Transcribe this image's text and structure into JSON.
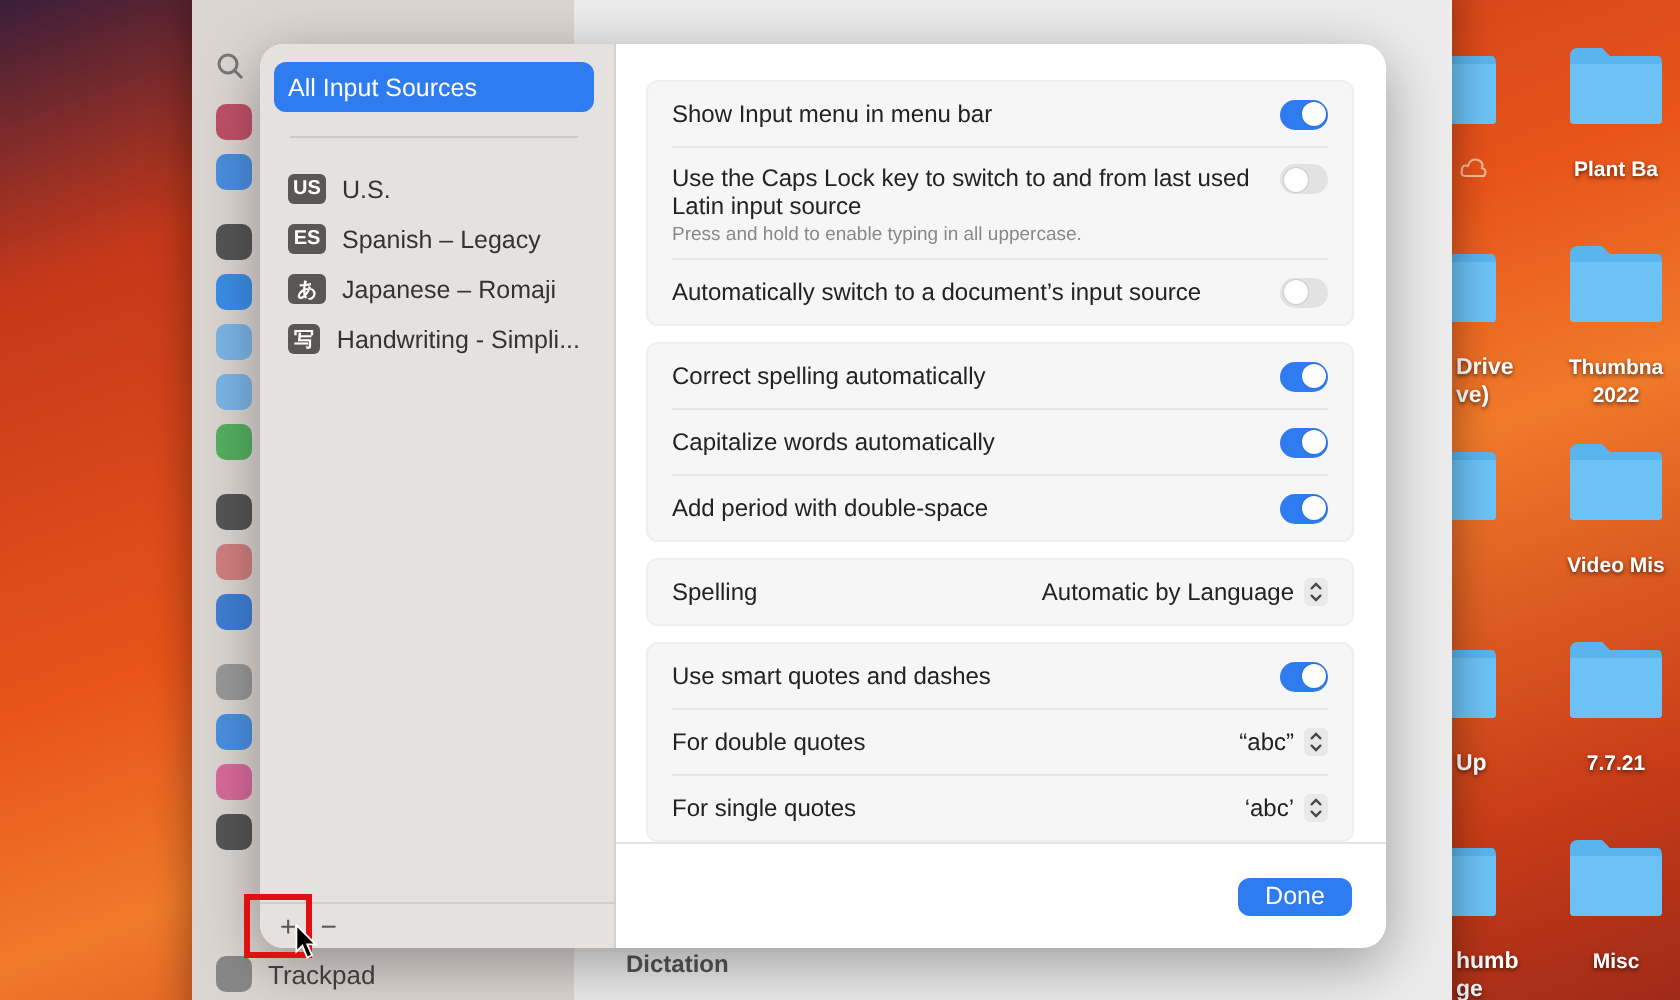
{
  "desktop": {
    "left_folders": [
      {
        "cloud": true
      },
      {
        "lines": [
          "Drive",
          "ve)"
        ]
      },
      {
        "cloud": false
      },
      {
        "lines": [
          "Up"
        ]
      },
      {
        "lines": [
          "humb",
          "ge"
        ]
      }
    ],
    "right_folders": [
      {
        "lines": [
          "Plant Ba"
        ]
      },
      {
        "lines": [
          "Thumbna",
          "2022"
        ]
      },
      {
        "lines": [
          "Video Mis"
        ]
      },
      {
        "lines": [
          "7.7.21"
        ]
      },
      {
        "lines": [
          "Misc"
        ]
      }
    ]
  },
  "settings_window": {
    "sidebar_bottom_item": "Trackpad",
    "section_heading": "Dictation"
  },
  "dialog": {
    "sources": [
      {
        "label": "All Input Sources",
        "selected": true
      },
      {
        "label": "U.S.",
        "badge": "US",
        "selected": false
      },
      {
        "label": "Spanish – Legacy",
        "badge": "ES",
        "selected": false
      },
      {
        "label": "Japanese – Romaji",
        "badge": "あ",
        "selected": false
      },
      {
        "label": "Handwriting - Simpli...",
        "badge": "写",
        "selected": false
      }
    ],
    "add_button": "+",
    "remove_button": "−",
    "groups": [
      {
        "rows": [
          {
            "kind": "toggle",
            "label": "Show Input menu in menu bar",
            "on": true
          },
          {
            "kind": "toggle",
            "label": "Use the Caps Lock key to switch to and from last used Latin input source",
            "note": "Press and hold to enable typing in all uppercase.",
            "on": false
          },
          {
            "kind": "toggle",
            "label": "Automatically switch to a document’s input source",
            "on": false
          }
        ]
      },
      {
        "rows": [
          {
            "kind": "toggle",
            "label": "Correct spelling automatically",
            "on": true
          },
          {
            "kind": "toggle",
            "label": "Capitalize words automatically",
            "on": true
          },
          {
            "kind": "toggle",
            "label": "Add period with double-space",
            "on": true
          }
        ]
      },
      {
        "rows": [
          {
            "kind": "popup",
            "label": "Spelling",
            "value": "Automatic by Language"
          }
        ]
      },
      {
        "rows": [
          {
            "kind": "toggle",
            "label": "Use smart quotes and dashes",
            "on": true
          },
          {
            "kind": "popup",
            "label": "For double quotes",
            "value": "“abc”"
          },
          {
            "kind": "popup",
            "label": "For single quotes",
            "value": "‘abc’"
          }
        ]
      }
    ],
    "done_button": "Done"
  }
}
